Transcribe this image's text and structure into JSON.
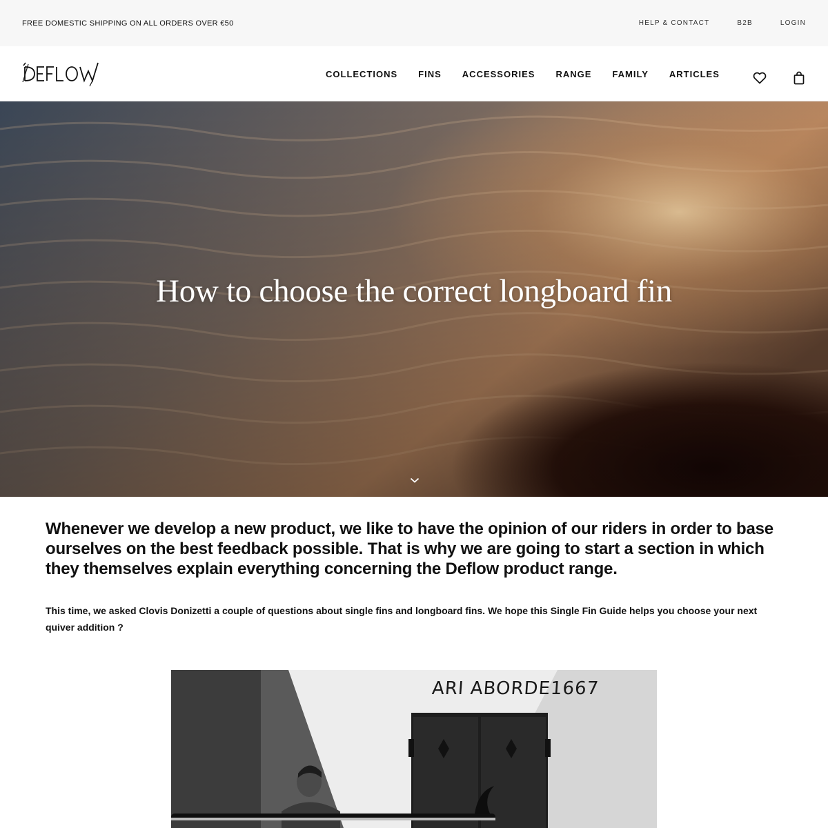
{
  "topbar": {
    "announcement": "FREE DOMESTIC SHIPPING ON ALL ORDERS OVER €50",
    "links": [
      "HELP & CONTACT",
      "B2B",
      "LOGIN"
    ]
  },
  "header": {
    "logo_text": "DEFLOW",
    "nav": [
      "COLLECTIONS",
      "FINS",
      "ACCESSORIES",
      "RANGE",
      "FAMILY",
      "ARTICLES"
    ],
    "icons": [
      "heart-icon",
      "shopping-bag-icon"
    ]
  },
  "hero": {
    "title": "How to choose the correct longboard fin",
    "scroll_icon": "chevron-down-icon"
  },
  "article": {
    "lead": "Whenever we develop a new product, we like to have the opinion of our riders in order to base ourselves on the best feedback possible. That is why we are going to start a section in which they themselves explain everything concerning the Deflow product range.",
    "intro": "This time, we asked Clovis Donizetti a couple of questions about single fins and longboard fins. We hope this Single Fin Guide helps you choose your next quiver addition ?"
  },
  "photo": {
    "wall_text": "ARI ABORDE1667"
  },
  "colors": {
    "topbar_bg": "#f7f7f7",
    "text": "#111111",
    "hero_title": "#ffffff"
  }
}
